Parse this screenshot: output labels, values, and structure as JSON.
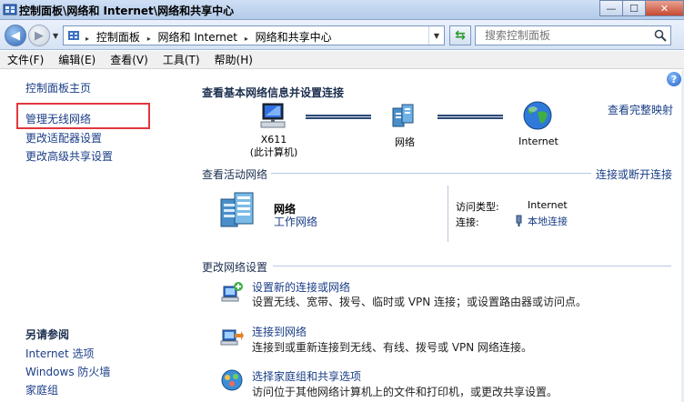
{
  "window": {
    "title": "控制面板\\网络和 Internet\\网络和共享中心",
    "buttons": {
      "minimize": "—",
      "maximize": "☐",
      "close": "✕"
    }
  },
  "address": {
    "crumbs": [
      "控制面板",
      "网络和 Internet",
      "网络和共享中心"
    ],
    "search_placeholder": "搜索控制面板"
  },
  "menu": [
    "文件(F)",
    "编辑(E)",
    "查看(V)",
    "工具(T)",
    "帮助(H)"
  ],
  "sidebar": {
    "items": [
      {
        "label": "控制面板主页"
      },
      {
        "label": "管理无线网络"
      },
      {
        "label": "更改适配器设置"
      },
      {
        "label": "更改高级共享设置"
      }
    ],
    "see_also_title": "另请参阅",
    "see_also": [
      {
        "label": "Internet 选项"
      },
      {
        "label": "Windows 防火墙"
      },
      {
        "label": "家庭组"
      }
    ]
  },
  "main": {
    "heading": "查看基本网络信息并设置连接",
    "full_map_link": "查看完整映射",
    "map": {
      "computer_name": "X611",
      "computer_sub": "(此计算机)",
      "network_label": "网络",
      "internet_label": "Internet"
    },
    "active_networks": {
      "title": "查看活动网络",
      "connect_link": "连接或断开连接",
      "network_name": "网络",
      "network_type": "工作网络",
      "access_type_label": "访问类型:",
      "access_type_value": "Internet",
      "connections_label": "连接:",
      "connections_value": "本地连接"
    },
    "change_settings": {
      "title": "更改网络设置",
      "tasks": [
        {
          "link": "设置新的连接或网络",
          "desc": "设置无线、宽带、拨号、临时或 VPN 连接；或设置路由器或访问点。"
        },
        {
          "link": "连接到网络",
          "desc": "连接到或重新连接到无线、有线、拨号或 VPN 网络连接。"
        },
        {
          "link": "选择家庭组和共享选项",
          "desc": "访问位于其他网络计算机上的文件和打印机，或更改共享设置。"
        }
      ]
    }
  },
  "colors": {
    "link": "#1a3d86",
    "highlight": "#e0383d",
    "heading": "#1c2f4f"
  },
  "icons": [
    "control-panel-icon",
    "back-arrow-icon",
    "forward-arrow-icon",
    "refresh-icon",
    "search-icon",
    "help-icon",
    "computer-icon",
    "network-icon",
    "globe-icon",
    "building-icon",
    "adapter-icon",
    "new-connection-icon",
    "connect-icon",
    "homegroup-icon"
  ]
}
